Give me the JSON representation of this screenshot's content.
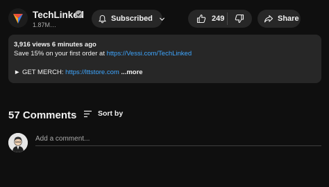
{
  "channel": {
    "name": "TechLinked",
    "subscribers": "1.87M…",
    "subscribe_label": "Subscribed"
  },
  "actions": {
    "like_count": "249",
    "share_label": "Share"
  },
  "description": {
    "stats": "3,916 views  6 minutes ago",
    "line1_prefix": "Save 15% on your first order at ",
    "line1_link": "https://Vessi.com/TechLinked",
    "line2_prefix": "► GET MERCH: ",
    "line2_link": "https://lttstore.com",
    "more_label": "...more"
  },
  "comments": {
    "count_label": "57 Comments",
    "sort_label": "Sort by",
    "placeholder": "Add a comment..."
  }
}
